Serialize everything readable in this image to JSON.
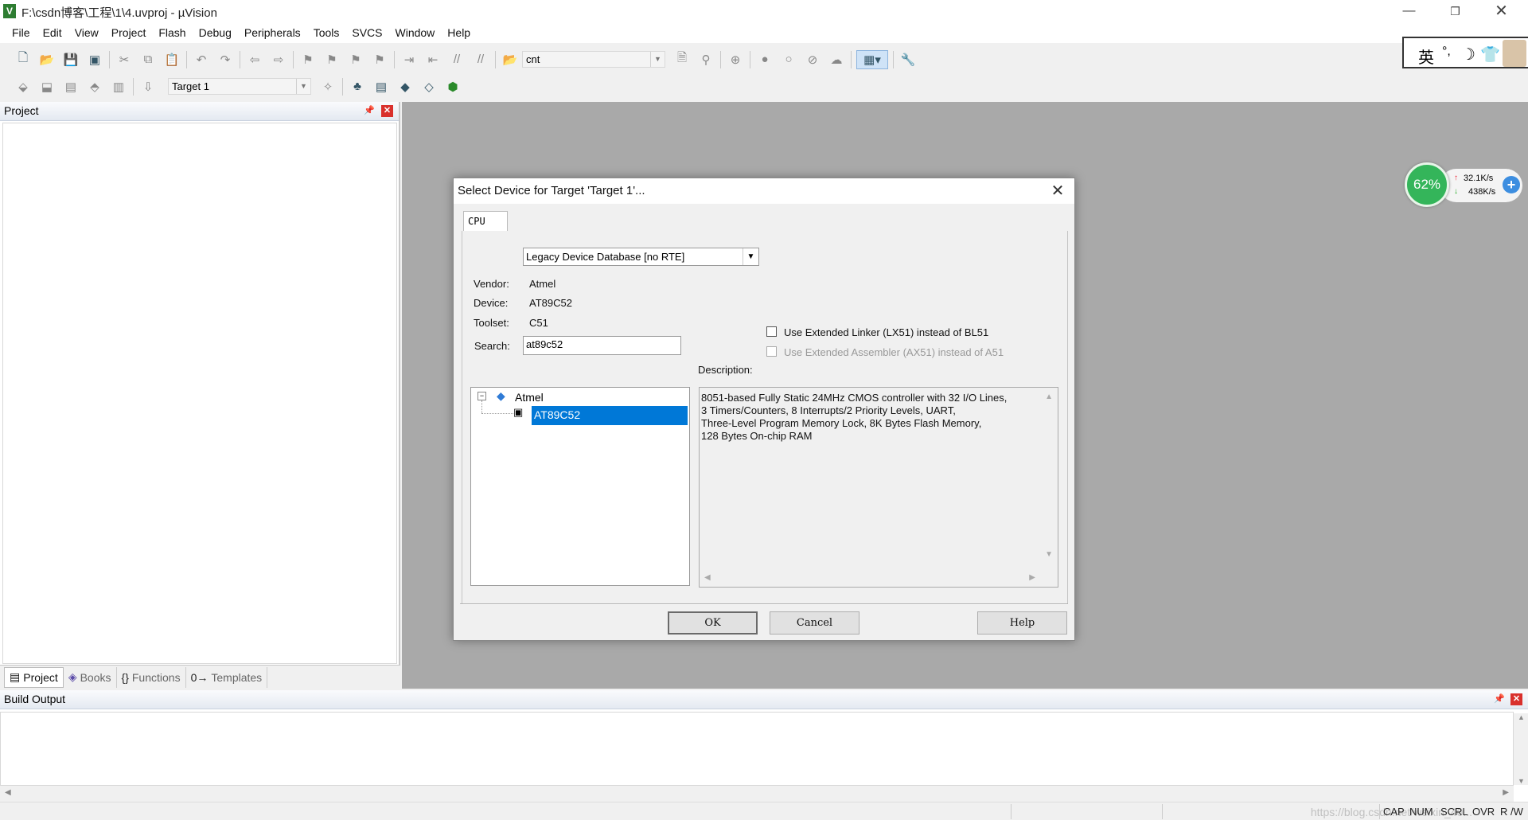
{
  "window": {
    "title": "F:\\csdn博客\\工程\\1\\4.uvproj - µVision",
    "app_icon": "V"
  },
  "menu": [
    "File",
    "Edit",
    "View",
    "Project",
    "Flash",
    "Debug",
    "Peripherals",
    "Tools",
    "SVCS",
    "Window",
    "Help"
  ],
  "toolbar": {
    "find_value": "cnt",
    "target_value": "Target 1"
  },
  "ime": {
    "lang": "英",
    "punct": "°,",
    "moon": "☽",
    "shirt": "👕"
  },
  "project_pane": {
    "title": "Project",
    "tabs": [
      {
        "icon": "▤",
        "label": "Project"
      },
      {
        "icon": "◈",
        "label": "Books"
      },
      {
        "icon": "{}",
        "label": "Functions"
      },
      {
        "icon": "0→",
        "label": "Templates"
      }
    ]
  },
  "network_widget": {
    "percent": "62%",
    "up": "32.1K/s",
    "down": "438K/s"
  },
  "build_output": {
    "title": "Build Output"
  },
  "status": {
    "items": [
      "CAP",
      "NUM",
      "SCRL",
      "OVR",
      "R /W"
    ],
    "watermark": "https://blog.csdn.net/weixin_40..."
  },
  "dialog": {
    "title": "Select Device for Target 'Target 1'...",
    "tab": "CPU",
    "database": "Legacy Device Database [no RTE]",
    "vendor_label": "Vendor:",
    "vendor_value": "Atmel",
    "device_label": "Device:",
    "device_value": "AT89C52",
    "toolset_label": "Toolset:",
    "toolset_value": "C51",
    "search_label": "Search:",
    "search_value": "at89c52",
    "linker_option": "Use Extended Linker (LX51) instead of BL51",
    "assembler_option": "Use Extended Assembler (AX51) instead of A51",
    "linker_checked": false,
    "assembler_checked": false,
    "description_label": "Description:",
    "description": "8051-based Fully Static 24MHz CMOS controller with 32  I/O Lines,\n3 Timers/Counters, 8 Interrupts/2 Priority Levels, UART,\nThree-Level Program Memory Lock, 8K Bytes Flash Memory,\n128 Bytes On-chip RAM",
    "tree": {
      "vendor": "Atmel",
      "selected_device": "AT89C52"
    },
    "buttons": {
      "ok": "OK",
      "cancel": "Cancel",
      "help": "Help"
    },
    "selection_color": "#0078d7"
  }
}
